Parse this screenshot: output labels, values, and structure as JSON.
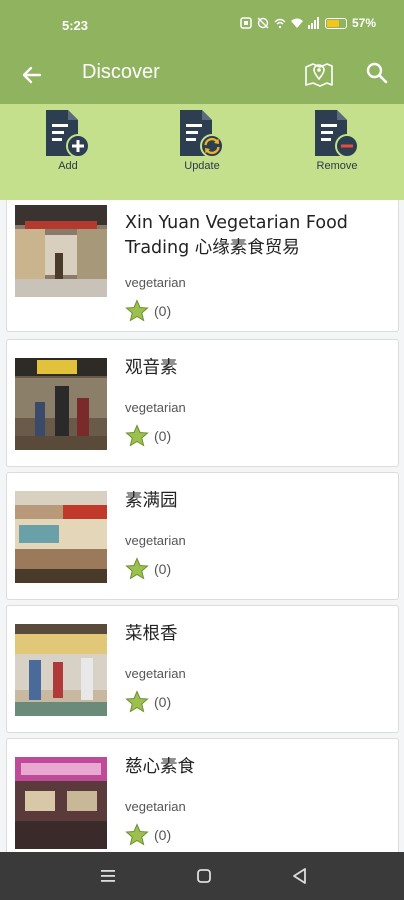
{
  "status_bar": {
    "time": "5:23",
    "battery": "57%"
  },
  "app_bar": {
    "title": "Discover"
  },
  "actions": [
    {
      "label": "Add",
      "icon": "doc-add-icon"
    },
    {
      "label": "Update",
      "icon": "doc-update-icon"
    },
    {
      "label": "Remove",
      "icon": "doc-remove-icon"
    }
  ],
  "places": [
    {
      "name": "Xin Yuan Vegetarian Food Trading  心缘素食贸易",
      "category": "vegetarian",
      "rating_count": "(0)"
    },
    {
      "name": "观音素",
      "category": "vegetarian",
      "rating_count": "(0)"
    },
    {
      "name": "素满园",
      "category": "vegetarian",
      "rating_count": "(0)"
    },
    {
      "name": "菜根香",
      "category": "vegetarian",
      "rating_count": "(0)"
    },
    {
      "name": "慈心素食",
      "category": "vegetarian",
      "rating_count": "(0)"
    }
  ],
  "colors": {
    "app_bar": "#8fb35f",
    "action_bar": "#c4e08c",
    "star": "#9cc04e",
    "doc_icon": "#2c3e50"
  }
}
